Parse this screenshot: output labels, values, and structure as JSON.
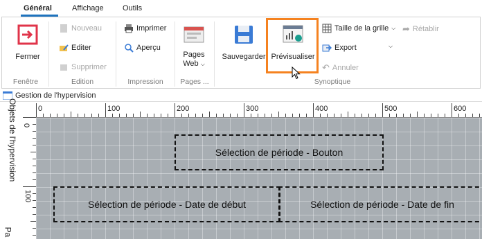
{
  "tabs": [
    {
      "label": "Général",
      "active": true
    },
    {
      "label": "Affichage",
      "active": false
    },
    {
      "label": "Outils",
      "active": false
    }
  ],
  "ribbon": {
    "fenetre": {
      "fermer": "Fermer",
      "group": "Fenêtre"
    },
    "edition": {
      "nouveau": "Nouveau",
      "editer": "Editer",
      "supprimer": "Supprimer",
      "group": "Edition"
    },
    "impression": {
      "imprimer": "Imprimer",
      "apercu": "Aperçu",
      "group": "Impression"
    },
    "pages": {
      "label_line1": "Pages",
      "label_line2": "Web",
      "group": "Pages ..."
    },
    "synoptique": {
      "sauvegarder": "Sauvegarder",
      "previsualiser": "Prévisualiser",
      "taille_grille": "Taille de la grille",
      "export": "Export",
      "retablir": "Rétablir",
      "annuler": "Annuler",
      "group": "Synoptique"
    }
  },
  "statusbar": {
    "title": "Gestion de l'hypervision"
  },
  "side_panel": {
    "label": "Objets de l'hypervision",
    "label2": "Pa"
  },
  "ruler_h_ticks": [
    "0",
    "100",
    "200",
    "300",
    "400",
    "500",
    "600"
  ],
  "ruler_v_ticks": [
    "0",
    "100"
  ],
  "canvas": {
    "boxes": [
      {
        "label": "Sélection de période - Bouton"
      },
      {
        "label": "Sélection de période - Date de début"
      },
      {
        "label": "Sélection de période - Date de fin"
      }
    ]
  },
  "colors": {
    "accent": "#1e73be",
    "highlight": "#f58220",
    "canvas": "#a8aeb3"
  }
}
